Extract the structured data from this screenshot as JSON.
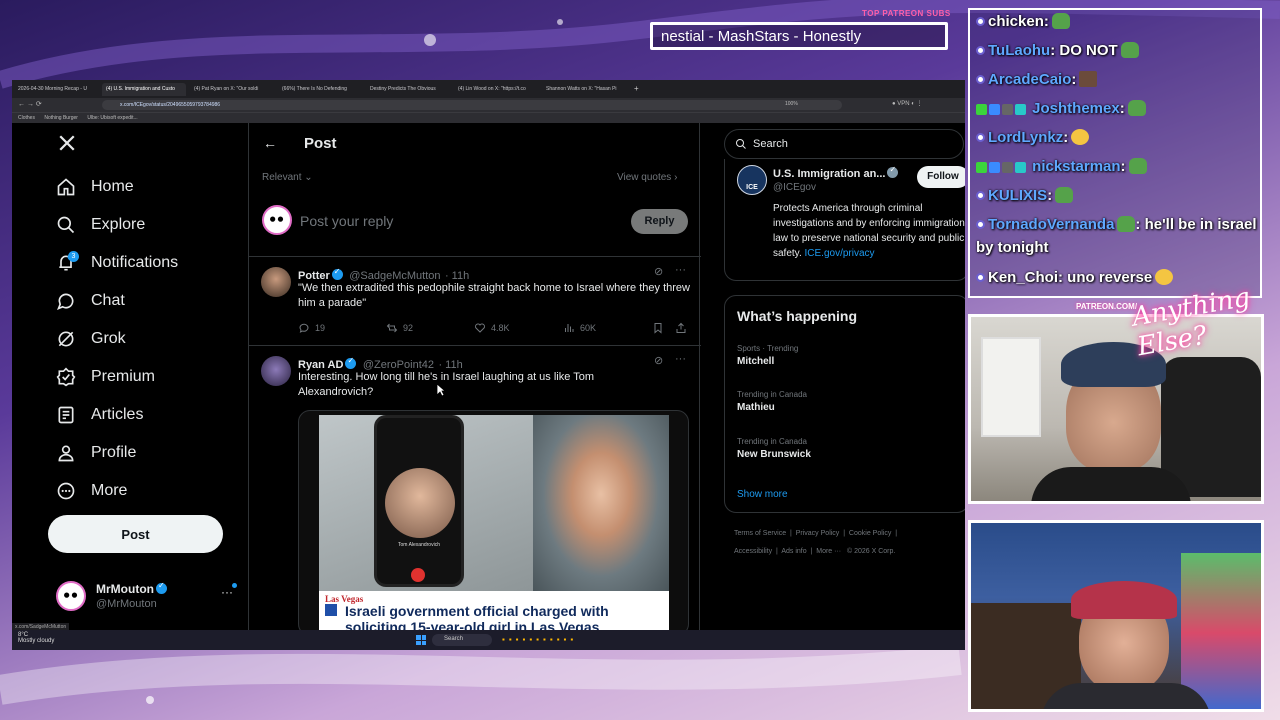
{
  "overlay": {
    "sub_label": "TOP PATREON SUBS",
    "sub_ticker": "nestial - MashStars - Honestly",
    "patreon_label": "PATREON.COM/",
    "logo_text": "Anything Else?"
  },
  "browser": {
    "tabs": [
      "2026-04-30 Morning Recap - U",
      "(4) U.S. Immigration and Custo",
      "(4) Pat Ryan on X: \"Our soldi",
      "(66%) There Is No Defending",
      "Destiny Predicts The Obvious",
      "(4) Lin Wood on X: \"https://t.co",
      "Shannon Watts on X: \"Hasan Pi"
    ],
    "url": "x.com/ICEgov/status/2049655059793784986",
    "zoom": "100%",
    "bookmarks": [
      "Clothes",
      "Nothing Burger",
      "Ulbe: Ubisoft expedit..."
    ],
    "status_url": "x.com/SadgeMcMutton"
  },
  "nav": {
    "items": [
      {
        "label": "Home",
        "icon": "home-icon"
      },
      {
        "label": "Explore",
        "icon": "search-icon"
      },
      {
        "label": "Notifications",
        "icon": "bell-icon",
        "badge": "3"
      },
      {
        "label": "Chat",
        "icon": "chat-icon"
      },
      {
        "label": "Grok",
        "icon": "grok-icon"
      },
      {
        "label": "Premium",
        "icon": "premium-icon"
      },
      {
        "label": "Articles",
        "icon": "articles-icon"
      },
      {
        "label": "Profile",
        "icon": "profile-icon"
      },
      {
        "label": "More",
        "icon": "more-icon"
      }
    ],
    "post_label": "Post",
    "account": {
      "name": "MrMouton",
      "handle": "@MrMouton"
    }
  },
  "header": {
    "title": "Post"
  },
  "filters": {
    "relevant": "Relevant",
    "view_quotes": "View quotes"
  },
  "reply": {
    "placeholder": "Post your reply",
    "button": "Reply"
  },
  "tweets": [
    {
      "name": "Potter",
      "handle": "@SadgeMcMutton",
      "time": "· 11h",
      "text": "\"We then extradited this pedophile straight back home to Israel where they threw him a parade\"",
      "replies": "19",
      "reposts": "92",
      "likes": "4.8K",
      "views": "60K"
    },
    {
      "name": "Ryan AD",
      "handle": "@ZeroPoint42",
      "time": "· 11h",
      "text": "Interesting. How long till he's in Israel laughing at us like Tom Alexandrovich?",
      "image": {
        "kicker": "Las Vegas",
        "headline": "Israeli government official charged with soliciting 15-year-old girl in Las Vegas",
        "phone_caption": "Tom Alexandrovich"
      }
    }
  ],
  "sidebar": {
    "search_placeholder": "Search",
    "profile": {
      "name": "U.S. Immigration an...",
      "handle": "@ICEgov",
      "follow": "Follow",
      "bio": "Protects America through criminal investigations and by enforcing immigration law to preserve national security and public safety.",
      "link": "ICE.gov/privacy",
      "avatar_label": "ICE"
    },
    "trends_title": "What’s happening",
    "trends": [
      {
        "category": "Sports · Trending",
        "name": "Mitchell"
      },
      {
        "category": "Trending in Canada",
        "name": "Mathieu"
      },
      {
        "category": "Trending in Canada",
        "name": "New Brunswick"
      }
    ],
    "show_more": "Show more",
    "footer": [
      "Terms of Service",
      "Privacy Policy",
      "Cookie Policy",
      "Accessibility",
      "Ads info",
      "More ···",
      "© 2026 X Corp."
    ]
  },
  "taskbar": {
    "temp": "8°C",
    "weather": "Mostly cloudy",
    "search": "Search"
  },
  "chat": [
    {
      "user": "chicken",
      "msg": ":",
      "emote": "pepe",
      "color": "#ffffff"
    },
    {
      "user": "TuLaohu",
      "msg": ": DO NOT",
      "emote": "pepe",
      "color": "#5fa8ff"
    },
    {
      "user": "ArcadeCaio",
      "msg": ":",
      "emote": "face",
      "color": "#5fa8ff"
    },
    {
      "user": "Joshthemex",
      "msg": ":",
      "emote": "pepe",
      "color": "#5fa8ff",
      "badges": true
    },
    {
      "user": "LordLynkz",
      "msg": ":",
      "emote": "yellow",
      "color": "#5fa8ff"
    },
    {
      "user": "nickstarman",
      "msg": ":",
      "emote": "pepe",
      "color": "#5fa8ff",
      "badges": true
    },
    {
      "user": "KULIXIS",
      "msg": ":",
      "emote": "pepe",
      "color": "#5fa8ff"
    },
    {
      "user": "TornadoVernanda",
      "msg": ": he'll be in israel by tonight",
      "emote": "pepe",
      "color": "#5fa8ff"
    },
    {
      "user": "Ken_Choi",
      "msg": ": uno reverse",
      "emote": "yellow",
      "color": "#ffffff"
    }
  ],
  "colors": {
    "x_blue": "#1d9bf0",
    "x_muted": "#71767b",
    "x_border": "#2f3336",
    "chat_name": "#5fa8ff",
    "accent_pink": "#ff3ca0"
  }
}
